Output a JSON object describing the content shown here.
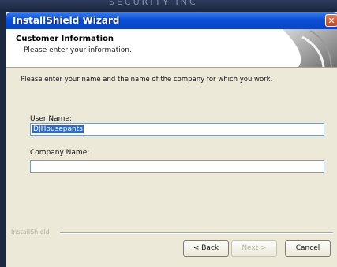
{
  "background": {
    "ghost_text": "SECURITY INC"
  },
  "window": {
    "title": "InstallShield Wizard",
    "close_glyph": "✕"
  },
  "header": {
    "title": "Customer Information",
    "subtitle": "Please enter your information."
  },
  "form": {
    "instructions": "Please enter your name and the name of the company for which you work.",
    "user_name_label": "User Name:",
    "user_name_value": "DJHousepants",
    "company_name_label": "Company Name:",
    "company_name_value": ""
  },
  "footer": {
    "brand": "InstallShield",
    "back_label": "< Back",
    "next_label": "Next >",
    "cancel_label": "Cancel"
  },
  "colors": {
    "titlebar": "#0b4fd8",
    "dialog_bg": "#ece9d8",
    "selection": "#316ac5"
  }
}
